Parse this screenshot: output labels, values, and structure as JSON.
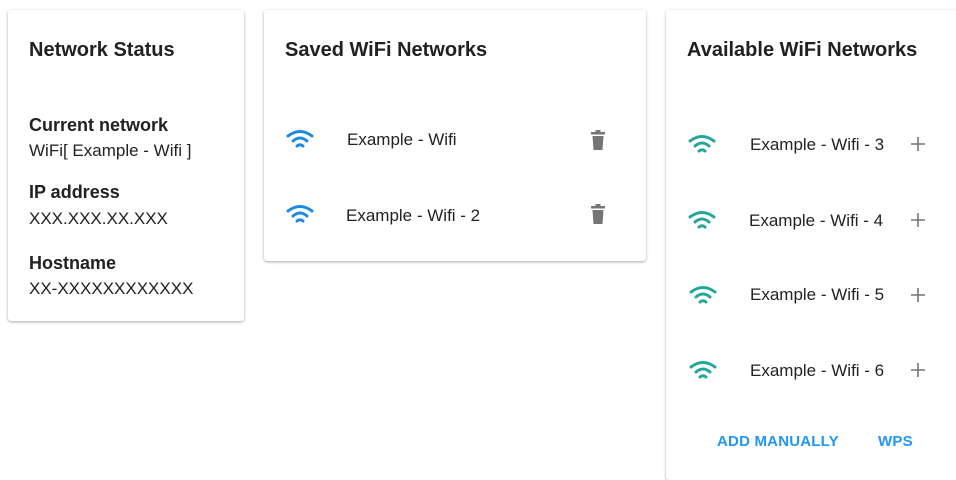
{
  "network_status": {
    "title": "Network Status",
    "current_network_label": "Current network",
    "current_network_value": "WiFi[ Example - Wifi ]",
    "ip_label": "IP address",
    "ip_value": "XXX.XXX.XX.XXX",
    "hostname_label": "Hostname",
    "hostname_value": "XX-XXXXXXXXXXXX"
  },
  "saved": {
    "title": "Saved WiFi Networks",
    "networks": [
      {
        "name": "Example - Wifi"
      },
      {
        "name": "Example - Wifi - 2"
      }
    ]
  },
  "available": {
    "title": "Available WiFi Networks",
    "networks": [
      {
        "name": "Example - Wifi - 3"
      },
      {
        "name": "Example - Wifi - 4"
      },
      {
        "name": "Example - Wifi - 5"
      },
      {
        "name": "Example - Wifi - 6"
      }
    ],
    "add_manually_label": "ADD MANUALLY",
    "wps_label": "WPS"
  },
  "colors": {
    "saved_wifi_icon": "#1e88e5",
    "available_wifi_icon": "#26a69a",
    "action": "#2196f3",
    "trash": "#757575",
    "plus": "#757575"
  }
}
